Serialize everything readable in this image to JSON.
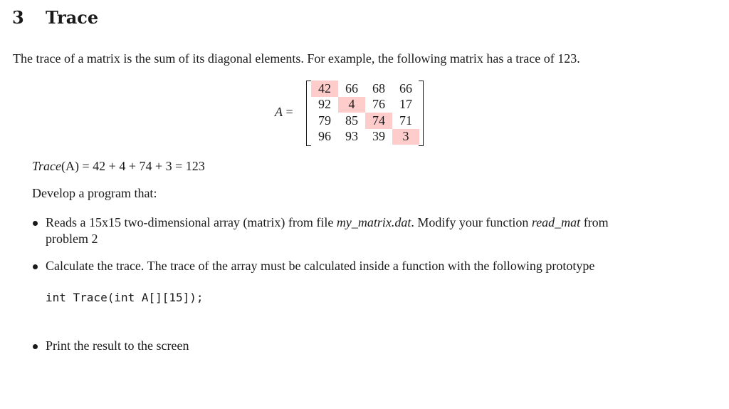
{
  "section": {
    "number": "3",
    "title": "Trace"
  },
  "intro": "The trace of a matrix is the sum of its diagonal elements. For example, the following matrix has a trace of 123.",
  "matrix": {
    "label_var": "A",
    "label_eq": " =",
    "highlight_color": "#ffcccc",
    "rows": [
      [
        "42",
        "66",
        "68",
        "66"
      ],
      [
        "92",
        "4",
        "76",
        "17"
      ],
      [
        "79",
        "85",
        "74",
        "71"
      ],
      [
        "96",
        "93",
        "39",
        "3"
      ]
    ]
  },
  "trace_equation": {
    "func": "Trace",
    "arg": "(A)",
    "rhs": " = 42 + 4 + 74 + 3 = 123"
  },
  "develop": "Develop a program that:",
  "items": [
    {
      "pre": "Reads a 15x15 two-dimensional array (matrix) from file ",
      "file": "my_matrix.dat",
      "mid": ". Modify your function ",
      "func": "read_mat",
      "post": " from",
      "line2": "problem 2"
    },
    {
      "text": "Calculate the trace. The trace of the array must be calculated inside a function with the following prototype",
      "code": "int Trace(int A[][15]);"
    },
    {
      "text": "Print the result to the screen"
    }
  ]
}
